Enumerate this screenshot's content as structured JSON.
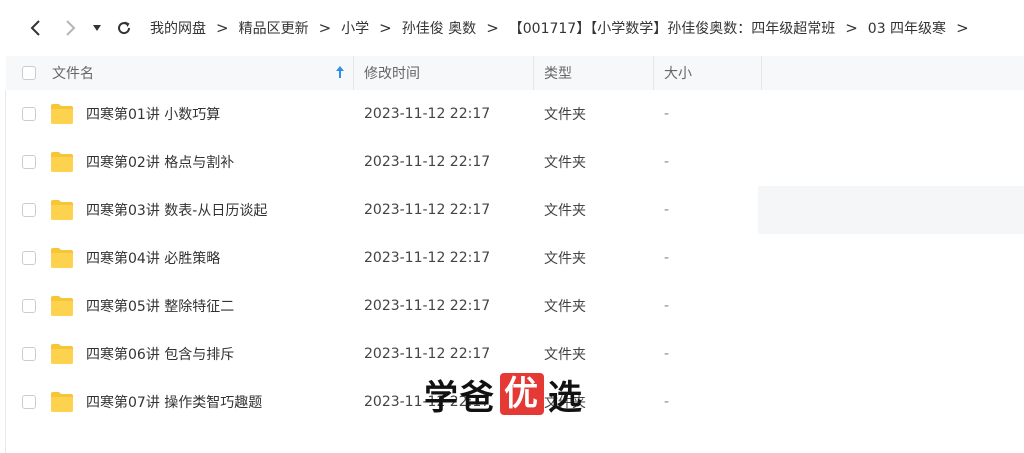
{
  "breadcrumb": [
    "我的网盘",
    "精品区更新",
    "小学",
    "孙佳俊 奥数",
    "【001717】【小学数学】孙佳俊奥数：四年级超常班",
    "03 四年级寒"
  ],
  "header": {
    "name": "文件名",
    "modified": "修改时间",
    "type": "类型",
    "size": "大小"
  },
  "rows": [
    {
      "name": "四寒第01讲 小数巧算",
      "modified": "2023-11-12 22:17",
      "type": "文件夹",
      "size": "-"
    },
    {
      "name": "四寒第02讲 格点与割补",
      "modified": "2023-11-12 22:17",
      "type": "文件夹",
      "size": "-"
    },
    {
      "name": "四寒第03讲 数表-从日历谈起",
      "modified": "2023-11-12 22:17",
      "type": "文件夹",
      "size": "-"
    },
    {
      "name": "四寒第04讲 必胜策略",
      "modified": "2023-11-12 22:17",
      "type": "文件夹",
      "size": "-"
    },
    {
      "name": "四寒第05讲 整除特征二",
      "modified": "2023-11-12 22:17",
      "type": "文件夹",
      "size": "-"
    },
    {
      "name": "四寒第06讲 包含与排斥",
      "modified": "2023-11-12 22:17",
      "type": "文件夹",
      "size": "-"
    },
    {
      "name": "四寒第07讲 操作类智巧趣题",
      "modified": "2023-11-12 22:17",
      "type": "文件夹",
      "size": "-"
    }
  ],
  "watermark": {
    "before": "学爸",
    "highlight": "优",
    "after": "选"
  },
  "colors": {
    "folder": "#f8c43a",
    "sort_arrow": "#2e8fe8",
    "watermark_box": "#e53935"
  }
}
